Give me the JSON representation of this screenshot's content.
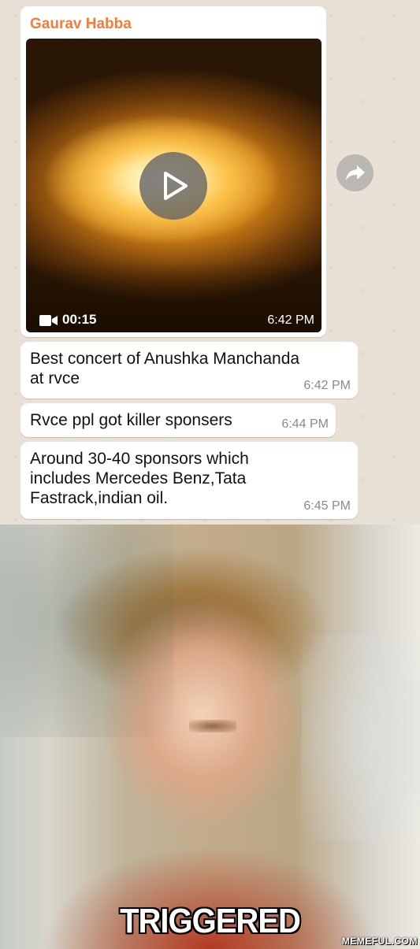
{
  "chat": {
    "video_message": {
      "sender": "Gaurav Habba",
      "duration": "00:15",
      "time": "6:42 PM"
    },
    "messages": [
      {
        "lines": [
          "Best concert of Anushka Manchanda",
          "at rvce"
        ],
        "time": "6:42 PM"
      },
      {
        "lines": [
          "Rvce ppl got killer sponsers"
        ],
        "time": "6:44 PM"
      },
      {
        "lines": [
          "Around 30-40 sponsors which",
          "includes Mercedes Benz,Tata",
          "Fastrack,indian oil."
        ],
        "time": "6:45 PM"
      }
    ],
    "icons": {
      "play": "play-icon",
      "camera": "video-camera-icon",
      "forward": "forward-icon"
    },
    "colors": {
      "sender": "#f07d3c",
      "bubble": "#ffffff",
      "background": "#e9e1d6"
    }
  },
  "meme": {
    "caption": "TRIGGERED",
    "watermark": "MEMEFUL.COM"
  }
}
